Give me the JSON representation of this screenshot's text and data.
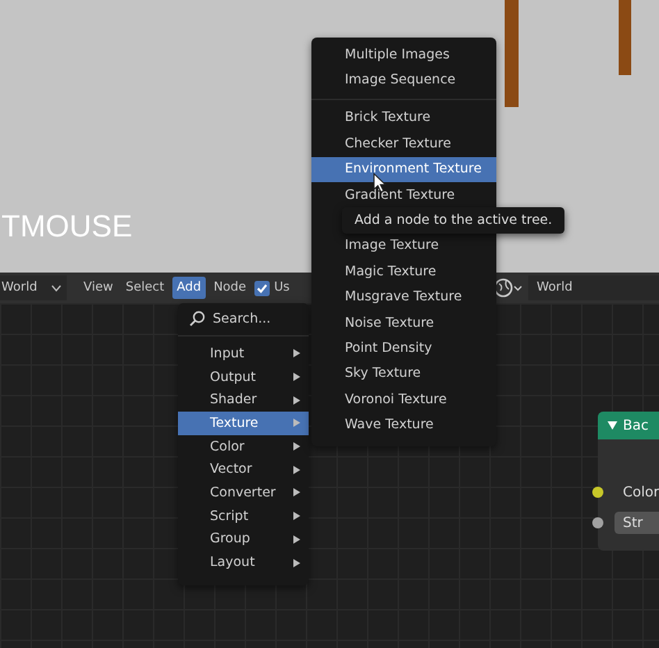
{
  "viewport": {
    "overlay_text": "TMOUSE"
  },
  "header": {
    "editor_dropdown": "World",
    "menus": [
      {
        "label": "View",
        "selected": false
      },
      {
        "label": "Select",
        "selected": false
      },
      {
        "label": "Add",
        "selected": true
      },
      {
        "label": "Node",
        "selected": false
      }
    ],
    "use_nodes": {
      "label": "Us",
      "checked": true
    },
    "world_field": "World"
  },
  "add_menu": {
    "search": "Search...",
    "items": [
      {
        "label": "Input",
        "selected": false
      },
      {
        "label": "Output",
        "selected": false
      },
      {
        "label": "Shader",
        "selected": false
      },
      {
        "label": "Texture",
        "selected": true
      },
      {
        "label": "Color",
        "selected": false
      },
      {
        "label": "Vector",
        "selected": false
      },
      {
        "label": "Converter",
        "selected": false
      },
      {
        "label": "Script",
        "selected": false
      },
      {
        "label": "Group",
        "selected": false
      },
      {
        "label": "Layout",
        "selected": false
      }
    ]
  },
  "texture_menu": {
    "groups": [
      [
        {
          "label": "Multiple Images",
          "selected": false
        },
        {
          "label": "Image Sequence",
          "selected": false
        }
      ],
      [
        {
          "label": "Brick Texture",
          "selected": false
        },
        {
          "label": "Checker Texture",
          "selected": false
        },
        {
          "label": "Environment Texture",
          "selected": true
        },
        {
          "label": "Gradient Texture",
          "selected": false
        },
        {
          "label": "Image Texture",
          "selected": false
        },
        {
          "label": "Magic Texture",
          "selected": false
        },
        {
          "label": "Musgrave Texture",
          "selected": false
        },
        {
          "label": "Noise Texture",
          "selected": false
        },
        {
          "label": "Point Density",
          "selected": false
        },
        {
          "label": "Sky Texture",
          "selected": false
        },
        {
          "label": "Voronoi Texture",
          "selected": false
        },
        {
          "label": "Wave Texture",
          "selected": false
        }
      ]
    ]
  },
  "tooltip": "Add a node to the active tree.",
  "node": {
    "title": "Bac",
    "socket_label": "Color",
    "field": "Str"
  }
}
